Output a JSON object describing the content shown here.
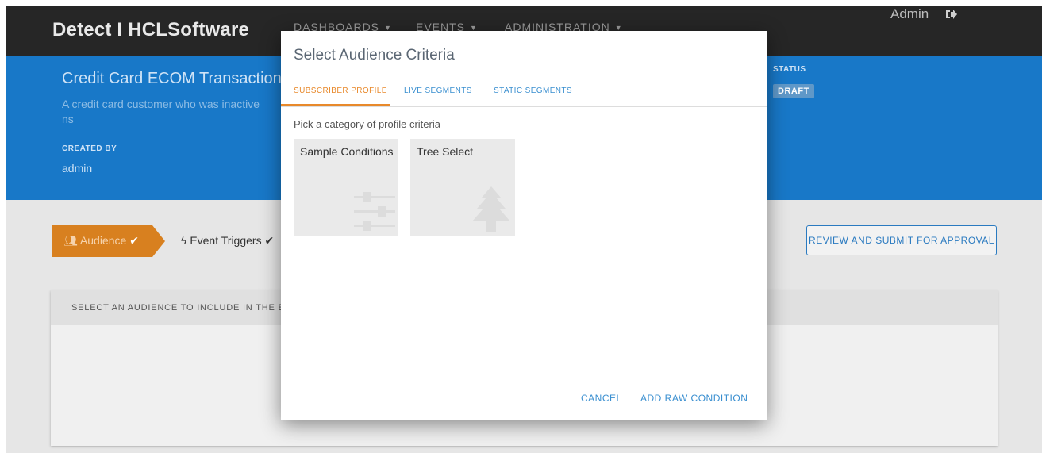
{
  "nav": {
    "brand": "Detect I HCLSoftware",
    "items": [
      {
        "label": "DASHBOARDS"
      },
      {
        "label": "EVENTS"
      },
      {
        "label": "ADMINISTRATION"
      }
    ],
    "user": "Admin",
    "logout_icon": "logout-icon"
  },
  "header": {
    "title": "Credit Card ECOM Transaction",
    "description": "A credit card customer who was inactive",
    "description_cont": "ns",
    "created_by_label": "CREATED BY",
    "created_by_value": "admin",
    "status_label": "STATUS",
    "status_value": "DRAFT"
  },
  "steps": {
    "audience": "Audience",
    "event_triggers": "Event Triggers"
  },
  "review_button": "REVIEW AND SUBMIT FOR APPROVAL",
  "panel": {
    "heading": "SELECT AN AUDIENCE TO INCLUDE IN THE EVE"
  },
  "modal": {
    "title": "Select Audience Criteria",
    "tabs": [
      {
        "label": "SUBSCRIBER PROFILE",
        "active": true
      },
      {
        "label": "LIVE SEGMENTS",
        "active": false
      },
      {
        "label": "STATIC SEGMENTS",
        "active": false
      }
    ],
    "prompt": "Pick a category of profile criteria",
    "cards": [
      {
        "label": "Sample Conditions",
        "icon": "sliders-icon"
      },
      {
        "label": "Tree Select",
        "icon": "tree-icon"
      }
    ],
    "cancel": "CANCEL",
    "add_raw": "ADD RAW CONDITION"
  },
  "colors": {
    "nav_bg": "#262626",
    "header_bg": "#1878c8",
    "accent_orange": "#e8892b",
    "link_blue": "#3a8fd0"
  }
}
